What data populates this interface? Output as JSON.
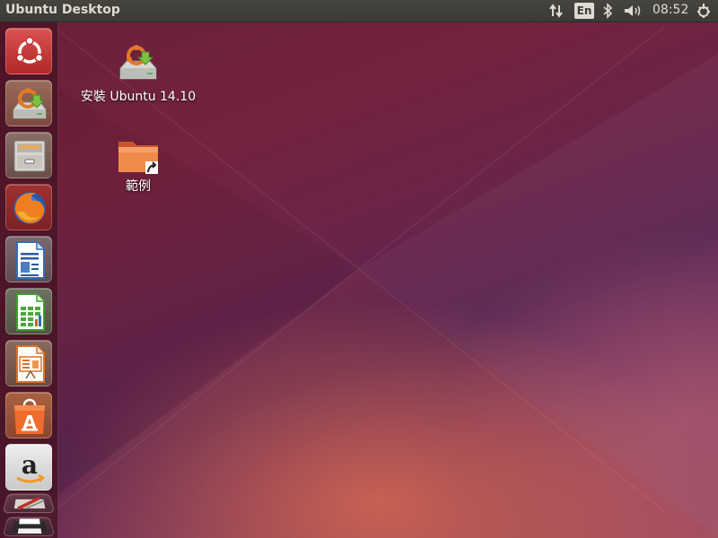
{
  "top_panel": {
    "window_title": "Ubuntu Desktop",
    "keyboard_layout": "En",
    "clock": "08:52",
    "indicators": [
      "network-transfer-icon",
      "bluetooth-icon",
      "volume-icon",
      "power-gear-icon"
    ]
  },
  "launcher": {
    "items": [
      {
        "icon": "ubuntu-dash-icon",
        "active": true
      },
      {
        "icon": "installer-icon"
      },
      {
        "icon": "file-manager-icon"
      },
      {
        "icon": "firefox-icon"
      },
      {
        "icon": "writer-icon"
      },
      {
        "icon": "calc-icon"
      },
      {
        "icon": "impress-icon"
      },
      {
        "icon": "software-center-icon"
      },
      {
        "icon": "amazon-icon"
      },
      {
        "icon": "settings-icon"
      },
      {
        "icon": "printer-icon"
      }
    ]
  },
  "desktop": {
    "icons": [
      {
        "label": "安裝 Ubuntu 14.10",
        "icon": "installer-icon"
      },
      {
        "label": "範例",
        "icon": "folder-link-icon"
      }
    ]
  },
  "colors": {
    "panel": "#3c3b37",
    "panel_text": "#dfdbd2",
    "ubuntu_orange": "#dd4814",
    "wallpaper_dark": "#5e2750"
  }
}
